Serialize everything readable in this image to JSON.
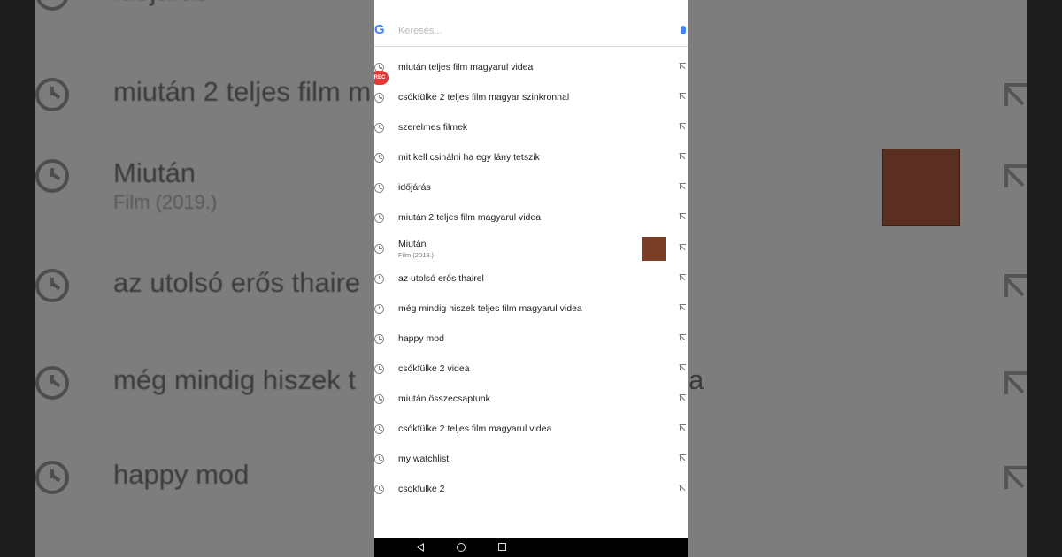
{
  "search": {
    "placeholder": "Keresés...",
    "logo_letter": "G",
    "logo_color": "#4285f4"
  },
  "recording_badge": "REC",
  "suggestions": [
    {
      "label": "miután teljes film magyarul videa"
    },
    {
      "label": "csókfülke 2 teljes film magyar szinkronnal"
    },
    {
      "label": "szerelmes filmek"
    },
    {
      "label": "mit kell csinálni ha egy lány tetszik"
    },
    {
      "label": "időjárás"
    },
    {
      "label": "miután 2 teljes film magyarul videa"
    },
    {
      "label": "Miután",
      "sublabel": "Film (2019.)",
      "thumb_color": "#7a3d26"
    },
    {
      "label": "az utolsó erős thairel"
    },
    {
      "label": "még mindig hiszek teljes film magyarul videa"
    },
    {
      "label": "happy mod"
    },
    {
      "label": "csókfülke 2 videa"
    },
    {
      "label": "miután összecsaptunk"
    },
    {
      "label": "csókfülke 2 teljes film magyarul videa"
    },
    {
      "label": "my watchlist"
    },
    {
      "label": "csokfulke 2"
    }
  ],
  "background": {
    "rows": [
      {
        "title": "időjárás"
      },
      {
        "title": "miután 2 teljes film m"
      },
      {
        "title": "Miután",
        "sub": "Film (2019.)"
      },
      {
        "title": "az utolsó erős thaire"
      },
      {
        "title": "még mindig hiszek t"
      },
      {
        "title": "happy mod"
      }
    ],
    "right_fragment": "a"
  },
  "nav": {
    "back_icon": "back-icon",
    "home_icon": "home-icon",
    "recent_icon": "recent-apps-icon"
  }
}
